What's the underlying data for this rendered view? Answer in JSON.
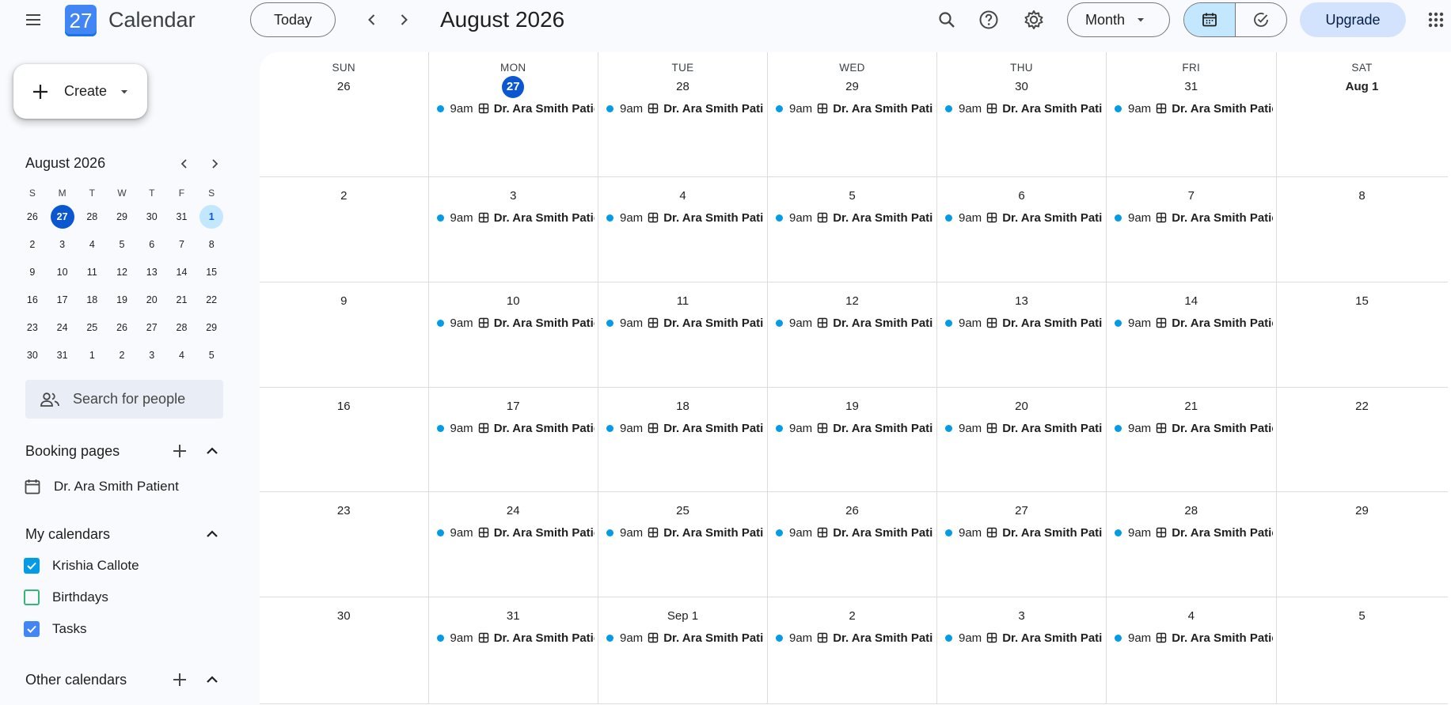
{
  "header": {
    "app_name": "Calendar",
    "logo_day": "27",
    "today_label": "Today",
    "title": "August 2026",
    "view_label": "Month",
    "upgrade_label": "Upgrade",
    "icons": [
      "main-menu-icon",
      "search-icon",
      "help-icon",
      "settings-icon",
      "calendar-view-icon",
      "tasks-view-icon",
      "apps-grid-icon",
      "chevron-left-icon",
      "chevron-right-icon"
    ]
  },
  "sidebar": {
    "create_label": "Create",
    "mini_title": "August 2026",
    "mini_days": [
      "S",
      "M",
      "T",
      "W",
      "T",
      "F",
      "S"
    ],
    "mini_weeks": [
      [
        "26",
        "27",
        "28",
        "29",
        "30",
        "31",
        "1"
      ],
      [
        "2",
        "3",
        "4",
        "5",
        "6",
        "7",
        "8"
      ],
      [
        "9",
        "10",
        "11",
        "12",
        "13",
        "14",
        "15"
      ],
      [
        "16",
        "17",
        "18",
        "19",
        "20",
        "21",
        "22"
      ],
      [
        "23",
        "24",
        "25",
        "26",
        "27",
        "28",
        "29"
      ],
      [
        "30",
        "31",
        "1",
        "2",
        "3",
        "4",
        "5"
      ]
    ],
    "search_placeholder": "Search for people",
    "booking_title": "Booking pages",
    "booking_item": "Dr. Ara Smith Patient",
    "my_calendars_title": "My calendars",
    "my_calendars": [
      {
        "label": "Krishia Callote",
        "checked": true,
        "color": "#039be5"
      },
      {
        "label": "Birthdays",
        "checked": false,
        "color": "#33b679"
      },
      {
        "label": "Tasks",
        "checked": true,
        "color": "#4285f4"
      }
    ],
    "other_calendars_title": "Other calendars"
  },
  "calendar": {
    "dow": [
      "SUN",
      "MON",
      "TUE",
      "WED",
      "THU",
      "FRI",
      "SAT"
    ],
    "weeks": [
      [
        "26",
        "27",
        "28",
        "29",
        "30",
        "31",
        "Aug 1"
      ],
      [
        "2",
        "3",
        "4",
        "5",
        "6",
        "7",
        "8"
      ],
      [
        "9",
        "10",
        "11",
        "12",
        "13",
        "14",
        "15"
      ],
      [
        "16",
        "17",
        "18",
        "19",
        "20",
        "21",
        "22"
      ],
      [
        "23",
        "24",
        "25",
        "26",
        "27",
        "28",
        "29"
      ],
      [
        "30",
        "31",
        "Sep 1",
        "2",
        "3",
        "4",
        "5"
      ]
    ],
    "event": {
      "time": "9am",
      "title": "Dr. Ara Smith Patient",
      "color": "#039be5"
    },
    "event_days": [
      1,
      2,
      3,
      4,
      5
    ]
  }
}
